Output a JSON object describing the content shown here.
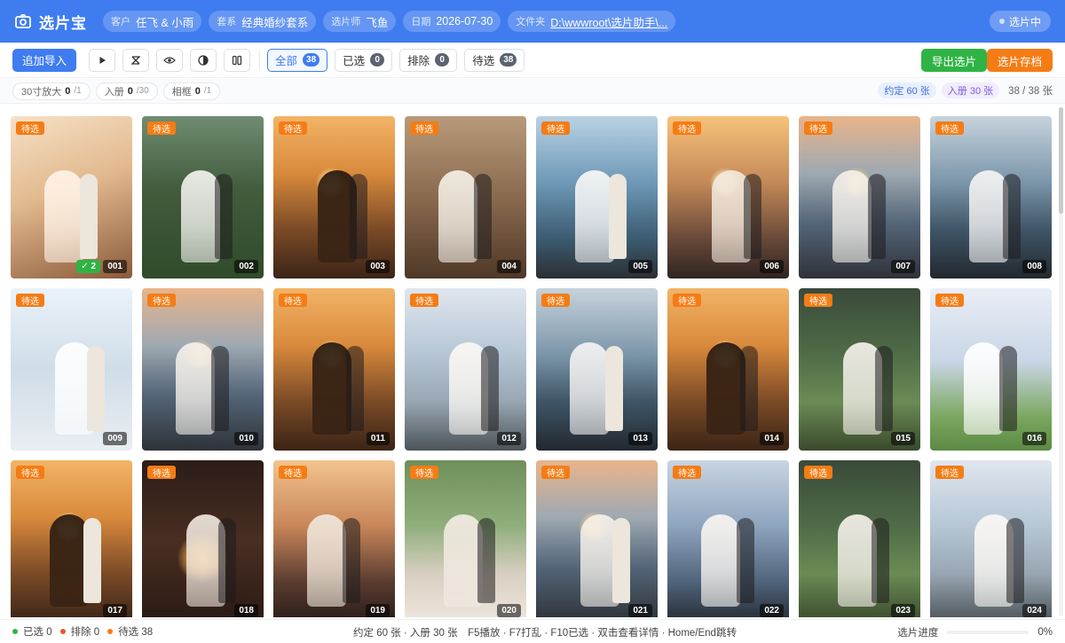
{
  "header": {
    "title": "选片宝",
    "fields": [
      {
        "key": "客户",
        "value": "任飞 & 小雨"
      },
      {
        "key": "套系",
        "value": "经典婚纱套系"
      },
      {
        "key": "选片师",
        "value": "飞鱼"
      },
      {
        "key": "日期",
        "value": "2026-07-30"
      },
      {
        "key": "文件夹",
        "value": "D:\\wwwroot\\选片助手\\..."
      }
    ],
    "status": "选片中"
  },
  "toolbar": {
    "import_label": "追加导入",
    "icons": [
      "play-icon",
      "shuffle-icon",
      "eye-icon",
      "contrast-icon",
      "compare-icon"
    ],
    "filters": [
      {
        "label": "全部",
        "count": "38",
        "active": true
      },
      {
        "label": "已选",
        "count": "0",
        "active": false
      },
      {
        "label": "排除",
        "count": "0",
        "active": false
      },
      {
        "label": "待选",
        "count": "38",
        "active": false
      }
    ],
    "export_label": "导出选片",
    "archive_label": "选片存档"
  },
  "quota": {
    "items": [
      {
        "label": "30寸放大",
        "value": "0",
        "max": "/1"
      },
      {
        "label": "入册",
        "value": "0",
        "max": "/30"
      },
      {
        "label": "相框",
        "value": "0",
        "max": "/1"
      }
    ],
    "agreed": "约定 60 张",
    "album": "入册 30 张",
    "count": "38 / 38 张"
  },
  "photos": [
    {
      "id": "001",
      "tag": "待选",
      "like": "2",
      "scene": "studio"
    },
    {
      "id": "002",
      "tag": "待选",
      "scene": "lawn"
    },
    {
      "id": "003",
      "tag": "待选",
      "scene": "sunset"
    },
    {
      "id": "004",
      "tag": "待选",
      "scene": "veil"
    },
    {
      "id": "005",
      "tag": "待选",
      "scene": "ocean"
    },
    {
      "id": "006",
      "tag": "待选",
      "scene": "sunset-gown"
    },
    {
      "id": "007",
      "tag": "待选",
      "scene": "dusk-sea"
    },
    {
      "id": "008",
      "tag": "待选",
      "scene": "rocks"
    },
    {
      "id": "009",
      "tag": "待选",
      "scene": "white"
    },
    {
      "id": "010",
      "tag": "待选",
      "scene": "dusk-sea"
    },
    {
      "id": "011",
      "tag": "待选",
      "scene": "sunset"
    },
    {
      "id": "012",
      "tag": "待选",
      "scene": "beach-sit"
    },
    {
      "id": "013",
      "tag": "待选",
      "scene": "rocks"
    },
    {
      "id": "014",
      "tag": "待选",
      "scene": "sunset"
    },
    {
      "id": "015",
      "tag": "待选",
      "scene": "lawn-dome"
    },
    {
      "id": "016",
      "tag": "待选",
      "scene": "field"
    },
    {
      "id": "017",
      "tag": "待选",
      "scene": "sunset"
    },
    {
      "id": "018",
      "tag": "待选",
      "scene": "moon"
    },
    {
      "id": "019",
      "tag": "待选",
      "scene": "sunset-rock"
    },
    {
      "id": "020",
      "tag": "待选",
      "scene": "portrait"
    },
    {
      "id": "021",
      "tag": "待选",
      "scene": "dusk-sea"
    },
    {
      "id": "022",
      "tag": "待选",
      "scene": "evening-sea"
    },
    {
      "id": "023",
      "tag": "待选",
      "scene": "lawn-dome"
    },
    {
      "id": "024",
      "tag": "待选",
      "scene": "beach-sit"
    }
  ],
  "statusbar": {
    "selected": "已选 0",
    "excluded": "排除 0",
    "pending": "待选 38",
    "hint": "约定 60 张 · 入册 30 张　F5播放 · F7打乱 · F10已选 · 双击查看详情 · Home/End跳转",
    "progress_label": "选片进度",
    "progress_value": "0%"
  },
  "colors": {
    "primary": "#3f7cf0",
    "success": "#2fb344",
    "warning": "#f57c14",
    "danger": "#e05a2b"
  }
}
